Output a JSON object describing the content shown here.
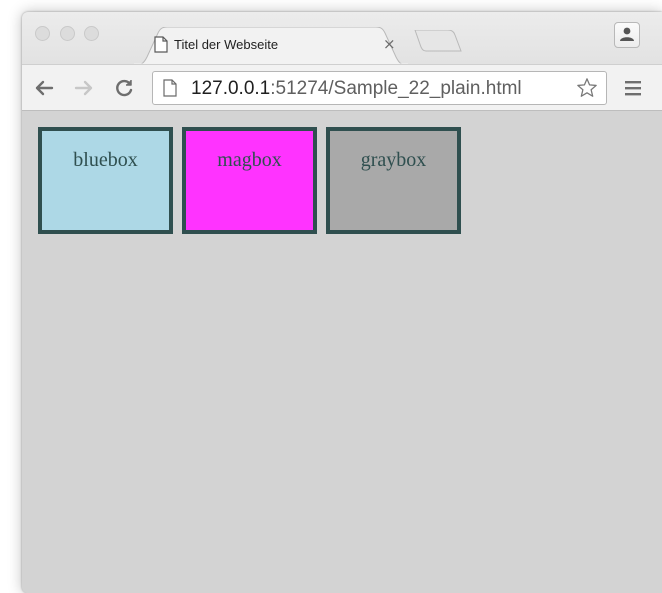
{
  "browser": {
    "tab": {
      "title": "Titel der Webseite",
      "close_glyph": "×"
    },
    "address": {
      "host": "127.0.0.1",
      "rest": ":51274/Sample_22_plain.html"
    },
    "icons": {
      "back": "back-arrow-icon",
      "forward": "forward-arrow-icon",
      "reload": "reload-icon",
      "page": "page-icon",
      "bookmark": "star-icon",
      "menu": "menu-icon",
      "profile": "person-icon"
    }
  },
  "page": {
    "background": "#d3d3d3",
    "border_color": "#2f4f4f",
    "boxes": [
      {
        "label": "bluebox",
        "color": "#add8e6"
      },
      {
        "label": "magbox",
        "color": "#ff33ff"
      },
      {
        "label": "graybox",
        "color": "#a9a9a9"
      }
    ]
  }
}
